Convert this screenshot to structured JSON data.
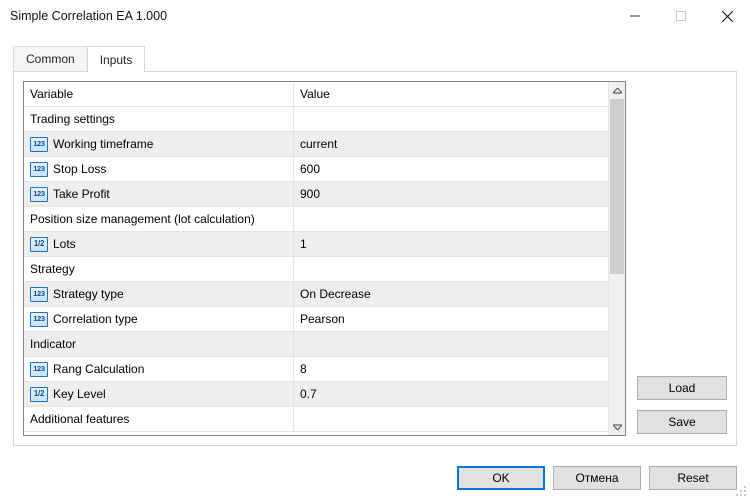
{
  "titlebar": {
    "title": "Simple Correlation EA 1.000"
  },
  "tabs": {
    "common": "Common",
    "inputs": "Inputs"
  },
  "header": {
    "variable": "Variable",
    "value": "Value"
  },
  "rows": {
    "r0": {
      "var": "Trading settings",
      "val": ""
    },
    "r1": {
      "var": "Working timeframe",
      "val": "current"
    },
    "r2": {
      "var": "Stop Loss",
      "val": "600"
    },
    "r3": {
      "var": "Take Profit",
      "val": "900"
    },
    "r4": {
      "var": "Position size management (lot calculation)",
      "val": ""
    },
    "r5": {
      "var": "Lots",
      "val": "1"
    },
    "r6": {
      "var": "Strategy",
      "val": ""
    },
    "r7": {
      "var": "Strategy type",
      "val": "On Decrease"
    },
    "r8": {
      "var": "Correlation type",
      "val": "Pearson"
    },
    "r9": {
      "var": "Indicator",
      "val": ""
    },
    "r10": {
      "var": "Rang Calculation",
      "val": "8"
    },
    "r11": {
      "var": "Key Level",
      "val": "0.7"
    },
    "r12": {
      "var": "Additional features",
      "val": ""
    }
  },
  "buttons": {
    "load": "Load",
    "save": "Save",
    "ok": "OK",
    "cancel": "Отмена",
    "reset": "Reset"
  }
}
